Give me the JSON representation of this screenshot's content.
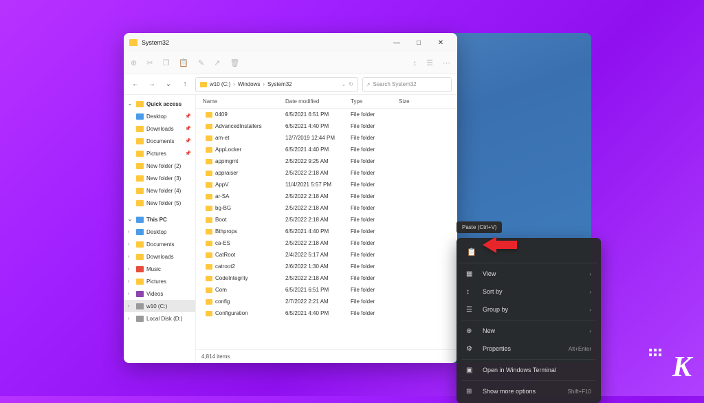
{
  "window": {
    "title": "System32",
    "minimize": "—",
    "maximize": "□",
    "close": "✕"
  },
  "address": {
    "drive": "w10 (C:)",
    "part1": "Windows",
    "part2": "System32"
  },
  "search": {
    "placeholder": "Search System32"
  },
  "columns": {
    "name": "Name",
    "modified": "Date modified",
    "type": "Type",
    "size": "Size"
  },
  "sidebar": {
    "quick": "Quick access",
    "items1": [
      {
        "label": "Desktop",
        "ic": "blue",
        "pin": true
      },
      {
        "label": "Downloads",
        "ic": "fold",
        "pin": true
      },
      {
        "label": "Documents",
        "ic": "fold",
        "pin": true
      },
      {
        "label": "Pictures",
        "ic": "fold",
        "pin": true
      },
      {
        "label": "New folder (2)",
        "ic": "fold"
      },
      {
        "label": "New folder (3)",
        "ic": "fold"
      },
      {
        "label": "New folder (4)",
        "ic": "fold"
      },
      {
        "label": "New folder (5)",
        "ic": "fold"
      }
    ],
    "thispc": "This PC",
    "items2": [
      {
        "label": "Desktop",
        "ic": "blue"
      },
      {
        "label": "Documents",
        "ic": "fold"
      },
      {
        "label": "Downloads",
        "ic": "fold"
      },
      {
        "label": "Music",
        "ic": "red"
      },
      {
        "label": "Pictures",
        "ic": "fold"
      },
      {
        "label": "Videos",
        "ic": "purp"
      },
      {
        "label": "w10 (C:)",
        "ic": "drv",
        "sel": true
      },
      {
        "label": "Local Disk (D:)",
        "ic": "drv"
      }
    ]
  },
  "files": [
    {
      "name": "0409",
      "date": "6/5/2021 6:51 PM",
      "type": "File folder"
    },
    {
      "name": "AdvancedInstallers",
      "date": "6/5/2021 4:40 PM",
      "type": "File folder"
    },
    {
      "name": "am-et",
      "date": "12/7/2019 12:44 PM",
      "type": "File folder"
    },
    {
      "name": "AppLocker",
      "date": "6/5/2021 4:40 PM",
      "type": "File folder"
    },
    {
      "name": "appmgmt",
      "date": "2/5/2022 9:25 AM",
      "type": "File folder"
    },
    {
      "name": "appraiser",
      "date": "2/5/2022 2:18 AM",
      "type": "File folder"
    },
    {
      "name": "AppV",
      "date": "11/4/2021 5:57 PM",
      "type": "File folder"
    },
    {
      "name": "ar-SA",
      "date": "2/5/2022 2:18 AM",
      "type": "File folder"
    },
    {
      "name": "bg-BG",
      "date": "2/5/2022 2:18 AM",
      "type": "File folder"
    },
    {
      "name": "Boot",
      "date": "2/5/2022 2:18 AM",
      "type": "File folder"
    },
    {
      "name": "Bthprops",
      "date": "6/5/2021 4:40 PM",
      "type": "File folder"
    },
    {
      "name": "ca-ES",
      "date": "2/5/2022 2:18 AM",
      "type": "File folder"
    },
    {
      "name": "CatRoot",
      "date": "2/4/2022 5:17 AM",
      "type": "File folder"
    },
    {
      "name": "catroot2",
      "date": "2/6/2022 1:30 AM",
      "type": "File folder"
    },
    {
      "name": "CodeIntegrity",
      "date": "2/5/2022 2:18 AM",
      "type": "File folder"
    },
    {
      "name": "Com",
      "date": "6/5/2021 6:51 PM",
      "type": "File folder"
    },
    {
      "name": "config",
      "date": "2/7/2022 2:21 AM",
      "type": "File folder"
    },
    {
      "name": "Configuration",
      "date": "6/5/2021 4:40 PM",
      "type": "File folder"
    }
  ],
  "status": "4,814 items",
  "tooltip": "Paste (Ctrl+V)",
  "ctx": {
    "view": "View",
    "sort": "Sort by",
    "group": "Group by",
    "new": "New",
    "props": "Properties",
    "props_sc": "Alt+Enter",
    "terminal": "Open in Windows Terminal",
    "more": "Show more options",
    "more_sc": "Shift+F10"
  },
  "logo": "K"
}
